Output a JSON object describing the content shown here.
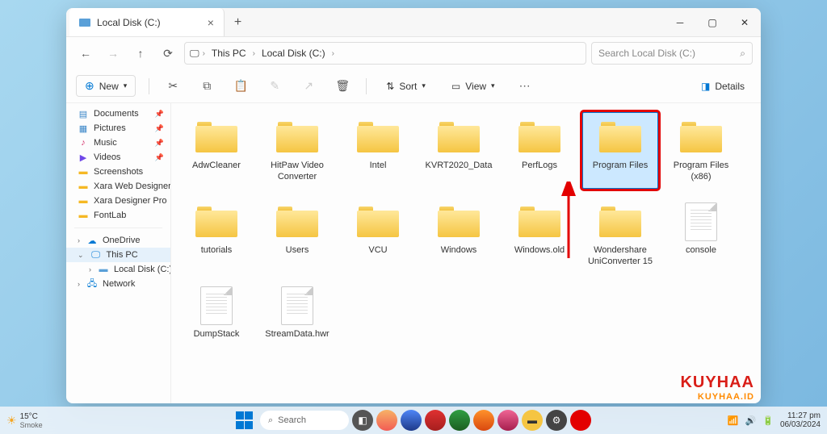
{
  "tab": {
    "title": "Local Disk (C:)"
  },
  "nav": {
    "breadcrumb": {
      "seg1": "This PC",
      "seg2": "Local Disk (C:)"
    },
    "search_placeholder": "Search Local Disk (C:)"
  },
  "toolbar": {
    "new": "New",
    "sort": "Sort",
    "view": "View",
    "details": "Details"
  },
  "sidebar": {
    "docs": "Documents",
    "pics": "Pictures",
    "music": "Music",
    "videos": "Videos",
    "screens": "Screenshots",
    "xara1": "Xara Web Designer",
    "xara2": "Xara Designer Pro",
    "fontlab": "FontLab",
    "onedrive": "OneDrive",
    "thispc": "This PC",
    "localdisk": "Local Disk (C:)",
    "network": "Network"
  },
  "items": [
    {
      "name": "AdwCleaner",
      "type": "folder"
    },
    {
      "name": "HitPaw Video Converter",
      "type": "folder"
    },
    {
      "name": "Intel",
      "type": "folder"
    },
    {
      "name": "KVRT2020_Data",
      "type": "folder"
    },
    {
      "name": "PerfLogs",
      "type": "folder"
    },
    {
      "name": "Program Files",
      "type": "folder",
      "selected": true,
      "highlighted": true
    },
    {
      "name": "Program Files (x86)",
      "type": "folder"
    },
    {
      "name": "tutorials",
      "type": "folder"
    },
    {
      "name": "Users",
      "type": "folder"
    },
    {
      "name": "VCU",
      "type": "folder"
    },
    {
      "name": "Windows",
      "type": "folder"
    },
    {
      "name": "Windows.old",
      "type": "folder"
    },
    {
      "name": "Wondershare UniConverter 15",
      "type": "folder"
    },
    {
      "name": "console",
      "type": "file"
    },
    {
      "name": "DumpStack",
      "type": "file"
    },
    {
      "name": "StreamData.hwr",
      "type": "file"
    }
  ],
  "weather": {
    "temp": "15°C",
    "desc": "Smoke"
  },
  "taskbar": {
    "search": "Search"
  },
  "clock": {
    "time": "11:27 pm",
    "date": "06/03/2024"
  },
  "watermark": {
    "line1": "KUYHAA",
    "line2": "KUYHAA.ID"
  }
}
